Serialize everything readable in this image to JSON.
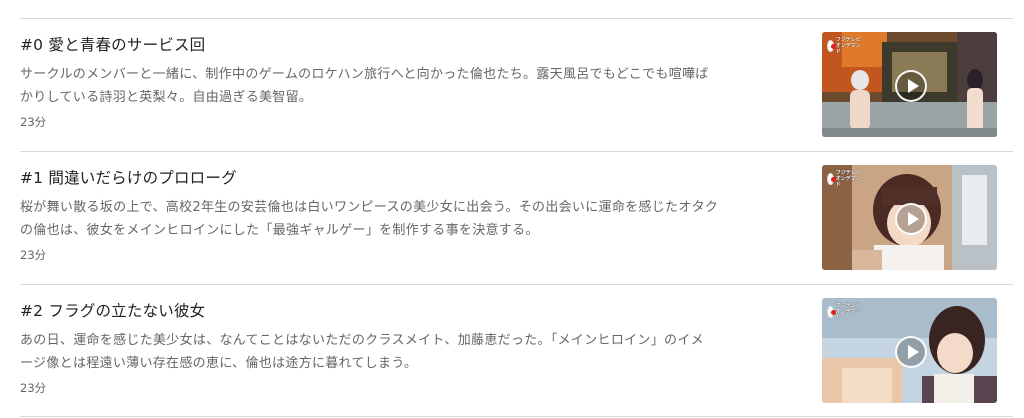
{
  "episodes": [
    {
      "title": "#0 愛と青春のサービス回",
      "description_line1": "サークルのメンバーと一緒に、制作中のゲームのロケハン旅行へと向かった倫也たち。露天風呂でもどこでも喧嘩ば",
      "description_line2": "かりしている詩羽と英梨々。自由過ぎる美智留。",
      "duration": "23分",
      "broadcaster_logo": "フジテレビ オンデマンド",
      "thumbnail_icon": "play-icon"
    },
    {
      "title": "#1 間違いだらけのプロローグ",
      "description_line1": "桜が舞い散る坂の上で、高校2年生の安芸倫也は白いワンピースの美少女に出会う。その出会いに運命を感じたオタク",
      "description_line2": "の倫也は、彼女をメインヒロインにした「最強ギャルゲー」を制作する事を決意する。",
      "duration": "23分",
      "broadcaster_logo": "フジテレビ オンデマンド",
      "thumbnail_icon": "play-icon"
    },
    {
      "title": "#2 フラグの立たない彼女",
      "description_line1": "あの日、運命を感じた美少女は、なんてことはないただのクラスメイト、加藤恵だった。「メインヒロイン」のイメ",
      "description_line2": "ージ像とは程遠い薄い存在感の恵に、倫也は途方に暮れてしまう。",
      "duration": "23分",
      "broadcaster_logo": "フジテレビ オンデマンド",
      "thumbnail_icon": "play-icon"
    }
  ]
}
